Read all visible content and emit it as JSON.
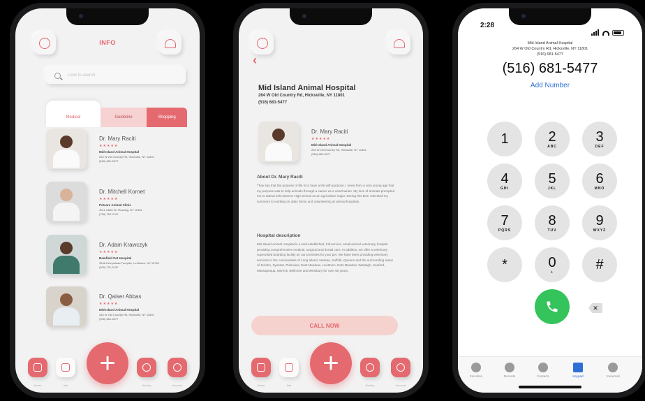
{
  "phone1": {
    "title": "INFO",
    "search_placeholder": "Look to search",
    "tabs": [
      "Medical",
      "Guideline",
      "Shopping"
    ],
    "doctors": [
      {
        "name": "Dr. Mary Raciti",
        "hospital": "Mid Island Animal Hospital",
        "address": "264 W Old Country Rd, Hicksville, NY 11801",
        "phone": "(516) 681-5477"
      },
      {
        "name": "Dr. Mitchell Kornet",
        "hospital": "Petcare Animal Clinic",
        "address": "4011 156th St, Flushing, NY 11354",
        "phone": "(718) 762-4747"
      },
      {
        "name": "Dr. Adam Krawczyk",
        "hospital": "Bemfield Pet Hospital",
        "address": "3546 Hempstead Turnpike, Levittown, NY 11756",
        "phone": "(516) 731-5132"
      },
      {
        "name": "Dr. Qaiser Abbas",
        "hospital": "Mid Island Animal Hospital",
        "address": "264 W Old Country Rd, Hicksville, NY 11801",
        "phone": "(516) 681-5477"
      }
    ],
    "tabbar": [
      "Home",
      "Info",
      "Nearby",
      "Account"
    ]
  },
  "phone2": {
    "hospital_name": "Mid Island Animal Hospital",
    "address": "264 W Old Country Rd, Hicksville, NY 11801",
    "phone": "(516) 681-5477",
    "doctor": {
      "name": "Dr. Mary Raciti",
      "hospital": "Mid Island Animal Hospital",
      "address": "264 W Old Country Rd, Hicksville, NY 11801",
      "phone": "(516) 681-5477"
    },
    "about_heading": "About Dr. Mary Raciti",
    "about_text": "They say that the purpose of life is to have a life with purpose. I knew from a very young age that my purpose was to help animals through a career as a veterinarian. My love of animals prompted me to attend John Bowne High School as an agriculture major. During this time I devoted my summers to working on dairy farms and volunteering at animal hospitals.",
    "desc_heading": "Hospital description",
    "desc_text": "Mid Island Animal Hospital is a well-established, full-service, small animal veterinary hospital providing comprehensive medical, surgical and dental care. In addition, we offer a veterinary supervised boarding facility on our premises for your pet. We have been providing veterinary services to the communities of Long Island, Nassau, Suffolk, Queens and the surrounding areas of Jericho, Syosset, Plainview, East Meadow, Levittown, East Meadow, Wantagh, Seaford, Massapequa, Merrick, Bellmore and Westbury for over 50 years.",
    "call_label": "CALL NOW",
    "tabbar": [
      "Home",
      "Info",
      "Nearby",
      "Account"
    ]
  },
  "phone3": {
    "time": "2:28",
    "contact_name": "Mid Island Animal Hospital",
    "contact_address": "264 W Old Country Rd, Hicksville, NY 11801",
    "contact_phone": "(516) 681-5477",
    "number": "(516) 681-5477",
    "add_number": "Add Number",
    "keys": [
      {
        "d": "1",
        "l": ""
      },
      {
        "d": "2",
        "l": "ABC"
      },
      {
        "d": "3",
        "l": "DEF"
      },
      {
        "d": "4",
        "l": "GHI"
      },
      {
        "d": "5",
        "l": "JKL"
      },
      {
        "d": "6",
        "l": "MNO"
      },
      {
        "d": "7",
        "l": "PQRS"
      },
      {
        "d": "8",
        "l": "TUV"
      },
      {
        "d": "9",
        "l": "WXYZ"
      },
      {
        "d": "*",
        "l": ""
      },
      {
        "d": "0",
        "l": "+"
      },
      {
        "d": "#",
        "l": ""
      }
    ],
    "dock": [
      "Favorites",
      "Recents",
      "Contacts",
      "Keypad",
      "Voicemail"
    ],
    "active_dock": "Keypad"
  },
  "colors": {
    "accent": "#e5676e",
    "call_green": "#35c45c",
    "link_blue": "#2e6fd6"
  }
}
